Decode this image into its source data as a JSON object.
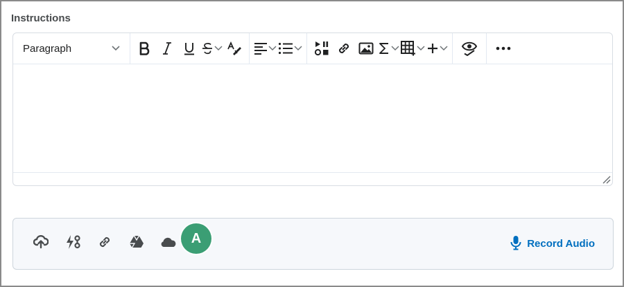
{
  "instructions_label": "Instructions",
  "toolbar": {
    "paragraph_select": "Paragraph",
    "buttons": {
      "bold": "bold-icon",
      "italic": "italic-icon",
      "underline": "underline-icon",
      "strikethrough": "strikethrough-icon",
      "spellcheck": "spellcheck-icon",
      "align": "align-left-icon",
      "list": "bullet-list-icon",
      "media": "insert-media-icon",
      "link": "link-icon",
      "image": "image-icon",
      "equation": "sigma-icon",
      "table": "table-icon",
      "insert": "plus-icon",
      "preview": "preview-eye-icon",
      "more": "more-icon"
    }
  },
  "attachments": {
    "icons": [
      "upload-cloud-icon",
      "quicklink-icon",
      "link-icon",
      "google-drive-icon",
      "onedrive-icon"
    ],
    "record_audio_label": "Record Audio"
  },
  "callout_marker": "A",
  "colors": {
    "accent": "#006fbf",
    "marker": "#3b9e74",
    "border": "#d8dde3",
    "attach_bg": "#f6f8fb"
  }
}
